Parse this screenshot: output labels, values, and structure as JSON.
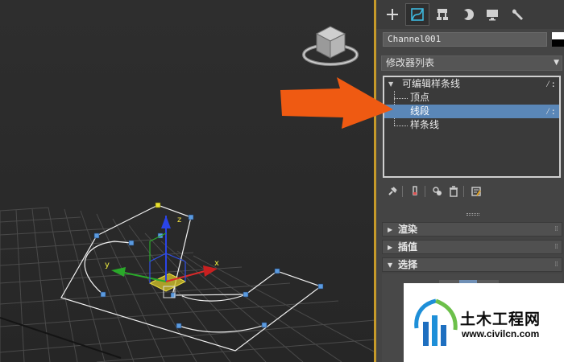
{
  "colors": {
    "viewport_bg": "#2c2c2c",
    "panel_bg": "#444444",
    "selection": "#5a87b8",
    "viewport_border": "#c69a2a",
    "callout_arrow": "#ef5a12",
    "spline_vertex": "#5b9be0",
    "first_vertex": "#e8e030"
  },
  "command_panel": {
    "tabs": [
      {
        "icon": "plus-icon",
        "active": false
      },
      {
        "icon": "modify-curve-icon",
        "active": true
      },
      {
        "icon": "hierarchy-icon",
        "active": false
      },
      {
        "icon": "motion-circle-icon",
        "active": false
      },
      {
        "icon": "display-monitor-icon",
        "active": false
      },
      {
        "icon": "utilities-wrench-icon",
        "active": false
      }
    ],
    "object_name": "Channel001",
    "modifier_list_label": "修改器列表",
    "modifier_stack": {
      "root": {
        "label": "可编辑样条线",
        "toggle": "⁄:"
      },
      "children": [
        {
          "label": "顶点",
          "selected": false
        },
        {
          "label": "线段",
          "selected": true,
          "toggle": "⁄:"
        },
        {
          "label": "样条线",
          "selected": false
        }
      ]
    },
    "stack_tool_icons": [
      "pin-stack-icon",
      "show-end-result-icon",
      "make-unique-icon",
      "remove-modifier-icon",
      "configure-sets-icon"
    ],
    "rollouts": [
      {
        "label": "渲染",
        "expanded": false
      },
      {
        "label": "插值",
        "expanded": false
      },
      {
        "label": "选择",
        "expanded": true
      }
    ]
  },
  "viewport": {
    "axis_labels": {
      "x": "x",
      "y": "y",
      "z": "z"
    }
  },
  "watermark": {
    "text": "土木工程网",
    "url": "www.civilcn.com"
  }
}
